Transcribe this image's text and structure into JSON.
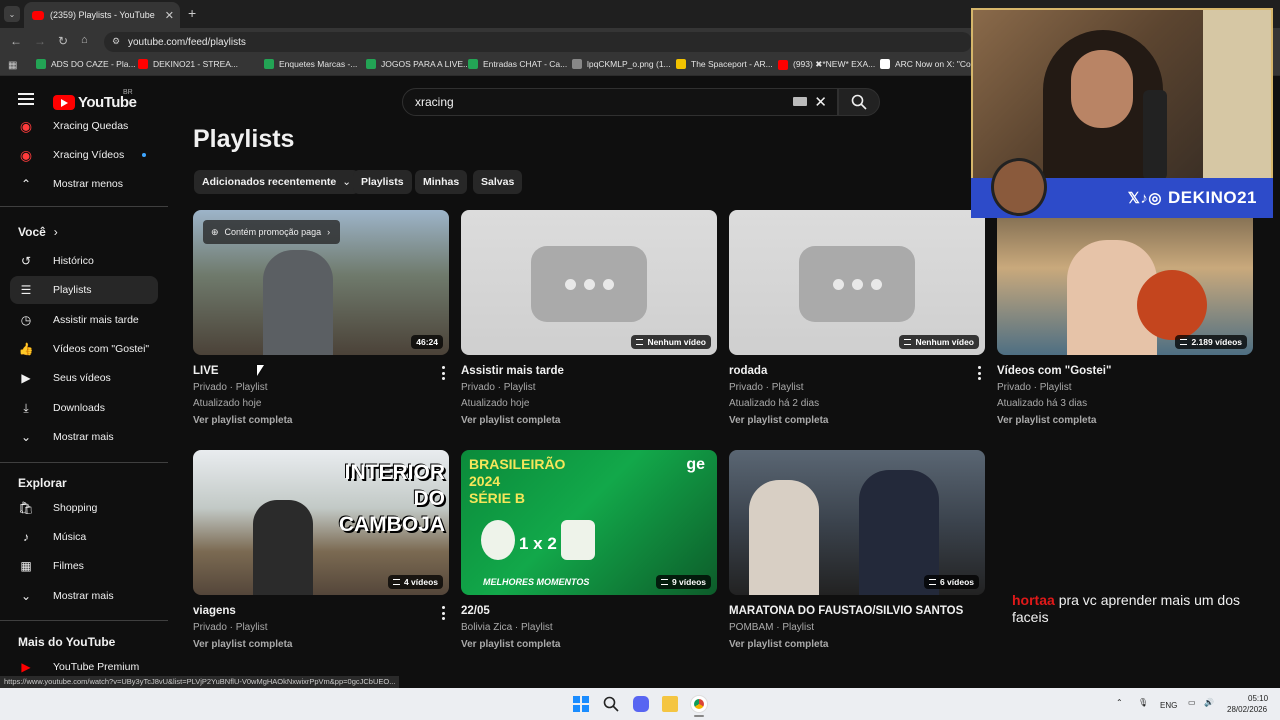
{
  "browser": {
    "tab_title": "(2359) Playlists - YouTube",
    "url": "youtube.com/feed/playlists",
    "bookmarks": [
      {
        "label": "ADS DO CAZE - Pla...",
        "color": "#23a455"
      },
      {
        "label": "DEKINO21 - STREA...",
        "color": "#ff0000"
      },
      {
        "label": "Enquetes Marcas -...",
        "color": "#23a455"
      },
      {
        "label": "JOGOS PARA A LIVE...",
        "color": "#23a455"
      },
      {
        "label": "Entradas CHAT - Ca...",
        "color": "#23a455"
      },
      {
        "label": "lpqCKMLP_o.png (1...",
        "color": "#888888"
      },
      {
        "label": "The Spaceport - AR...",
        "color": "#f2c200"
      },
      {
        "label": "(993) ✖*NEW* EXA...",
        "color": "#ff0000"
      },
      {
        "label": "ARC Now on X: \"Co...",
        "color": "#ffffff"
      }
    ]
  },
  "header": {
    "logo_text": "YouTube",
    "country_code": "BR",
    "search_value": "xracing"
  },
  "sidebar": {
    "top_items": [
      {
        "label": "Xracing Quedas",
        "icon": "channel-avatar-icon"
      },
      {
        "label": "Xracing Vídeos",
        "icon": "channel-avatar-icon"
      },
      {
        "label": "Mostrar menos",
        "icon": "chevron-up-icon"
      }
    ],
    "you_heading": "Você",
    "you_items": [
      {
        "label": "Histórico",
        "icon": "history-icon"
      },
      {
        "label": "Playlists",
        "icon": "playlists-icon"
      },
      {
        "label": "Assistir mais tarde",
        "icon": "watch-later-icon"
      },
      {
        "label": "Vídeos com \"Gostei\"",
        "icon": "thumbs-up-icon"
      },
      {
        "label": "Seus vídeos",
        "icon": "your-videos-icon"
      },
      {
        "label": "Downloads",
        "icon": "download-icon"
      },
      {
        "label": "Mostrar mais",
        "icon": "chevron-down-icon"
      }
    ],
    "explore_heading": "Explorar",
    "explore_items": [
      {
        "label": "Shopping",
        "icon": "shopping-bag-icon"
      },
      {
        "label": "Música",
        "icon": "music-icon"
      },
      {
        "label": "Filmes",
        "icon": "film-icon"
      },
      {
        "label": "Mostrar mais",
        "icon": "chevron-down-icon"
      }
    ],
    "more_heading": "Mais do YouTube",
    "more_items": [
      {
        "label": "YouTube Premium",
        "icon": "youtube-premium-icon"
      }
    ]
  },
  "main": {
    "title": "Playlists",
    "chips": [
      "Adicionados recentemente",
      "Playlists",
      "Minhas",
      "Salvas"
    ],
    "promo_label": "Contém promoção paga",
    "playlists": [
      {
        "title": "LIVE",
        "meta": "Privado · Playlist",
        "updated": "Atualizado hoje",
        "link": "Ver playlist completa",
        "badge": "46:24",
        "thumb": "photo-street"
      },
      {
        "title": "Assistir mais tarde",
        "meta": "Privado · Playlist",
        "updated": "Atualizado hoje",
        "link": "Ver playlist completa",
        "badge": "Nenhum vídeo",
        "thumb": "placeholder"
      },
      {
        "title": "rodada",
        "meta": "Privado · Playlist",
        "updated": "Atualizado há 2 dias",
        "link": "Ver playlist completa",
        "badge": "Nenhum vídeo",
        "thumb": "placeholder"
      },
      {
        "title": "Vídeos com \"Gostei\"",
        "meta": "Privado · Playlist",
        "updated": "Atualizado há 3 dias",
        "link": "Ver playlist completa",
        "badge": "2.189 vídeos",
        "thumb": "photo-city"
      },
      {
        "title": "viagens",
        "meta": "Privado · Playlist",
        "updated": "",
        "link": "Ver playlist completa",
        "badge": "4 vídeos",
        "thumb": "photo-camboja",
        "overlay_text": "INTERIOR DO CAMBOJA"
      },
      {
        "title": "22/05",
        "meta": "Bolivia Zica · Playlist",
        "updated": "",
        "link": "Ver playlist completa",
        "badge": "9 vídeos",
        "thumb": "photo-football",
        "overlay_text": "BRASILEIRÃO 2024 SÉRIE B",
        "score": "1 x 2",
        "footer_text": "MELHORES MOMENTOS",
        "logo_text": "ge"
      },
      {
        "title": "MARATONA DO FAUSTAO/SILVIO SANTOS",
        "meta": "POMBAM · Playlist",
        "updated": "",
        "link": "Ver playlist completa",
        "badge": "6 vídeos",
        "thumb": "photo-tv"
      }
    ]
  },
  "stream_overlay": {
    "banner_text": "DEKINO21",
    "chat_user": "hortaa",
    "chat_message": "pra vc aprender mais um dos faceis"
  },
  "statusbar_url": "https://www.youtube.com/watch?v=UBy3yTcJ8vU&list=PLVjP2YuBNflU-V0wMgHAOkNxwixrPpVm&pp=0gcJCbUEO...",
  "taskbar": {
    "language": "ENG",
    "time": "05:10",
    "date": "28/02/2026"
  },
  "colors": {
    "yt_red": "#ff0000",
    "background": "#0f0f0f",
    "chat_user": "#e01919",
    "banner": "#2d4bc9"
  }
}
